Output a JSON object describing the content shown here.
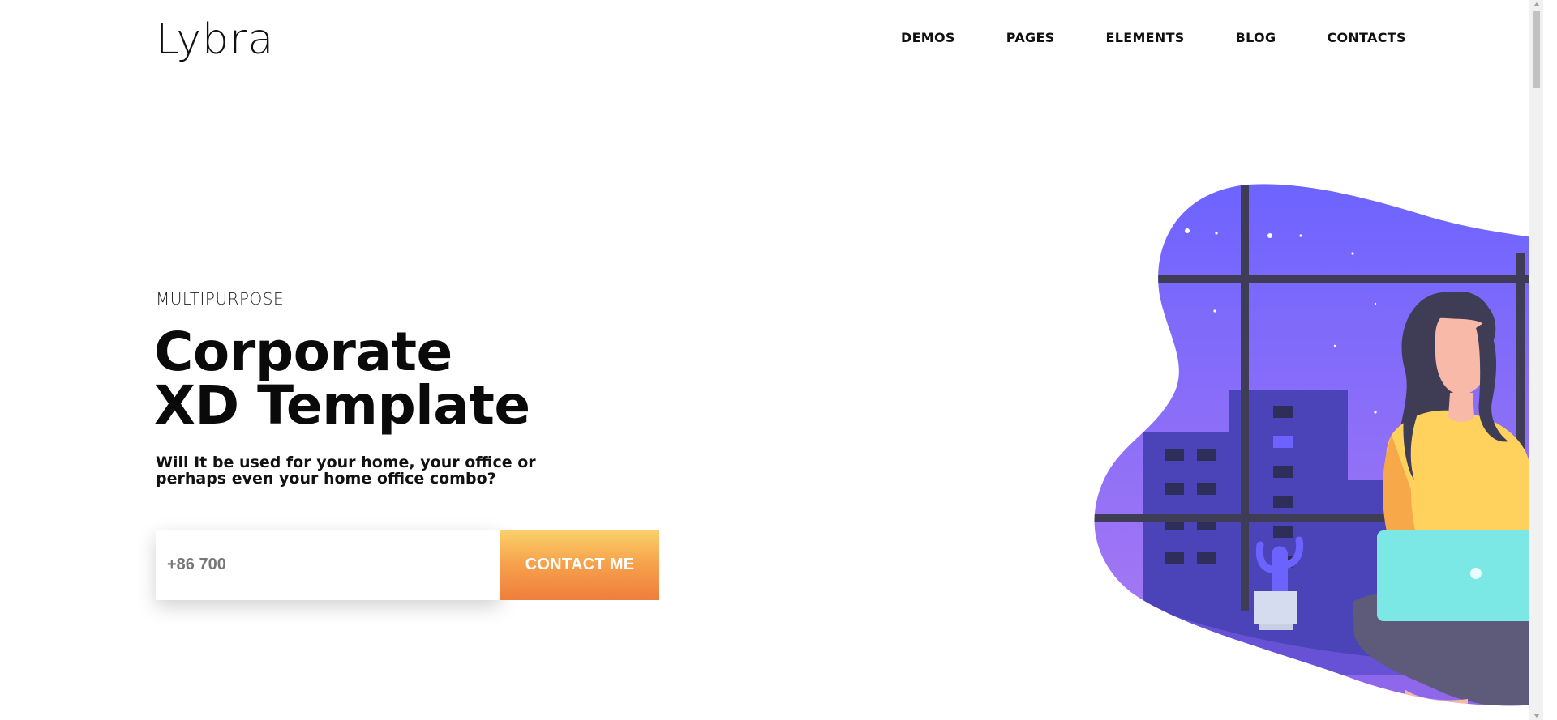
{
  "brand": {
    "logo_text": "Lybra"
  },
  "nav": {
    "items": [
      {
        "label": "DEMOS"
      },
      {
        "label": "PAGES"
      },
      {
        "label": "ELEMENTS"
      },
      {
        "label": "BLOG"
      },
      {
        "label": "CONTACTS"
      }
    ]
  },
  "hero": {
    "eyebrow": "MULTIPURPOSE",
    "headline_line1": "Corporate",
    "headline_line2": "XD Template",
    "subtitle": "Will It be used for your home, your office or perhaps even your home office combo?"
  },
  "form": {
    "phone_placeholder": "+86 700",
    "phone_value": "",
    "button_label": "CONTACT ME"
  },
  "illustration": {
    "icon": "woman-with-laptop-by-window-illustration",
    "colors": {
      "sky_top": "#6c63ff",
      "sky_bottom": "#b07cf0",
      "window_frame": "#3f3d56",
      "building": "#4b44b8",
      "window_dark": "#2f2e5a",
      "hair": "#3f3d56",
      "skin": "#f9b9a8",
      "sweater": "#ffd25e",
      "pants": "#5e5a7a",
      "laptop": "#7ce8e6",
      "cactus": "#6c63ff",
      "pot": "#d6dcef"
    }
  },
  "colors": {
    "button_gradient_top": "#fbd16a",
    "button_gradient_bottom": "#ef7e3a",
    "text_primary": "#0a0a0a"
  }
}
